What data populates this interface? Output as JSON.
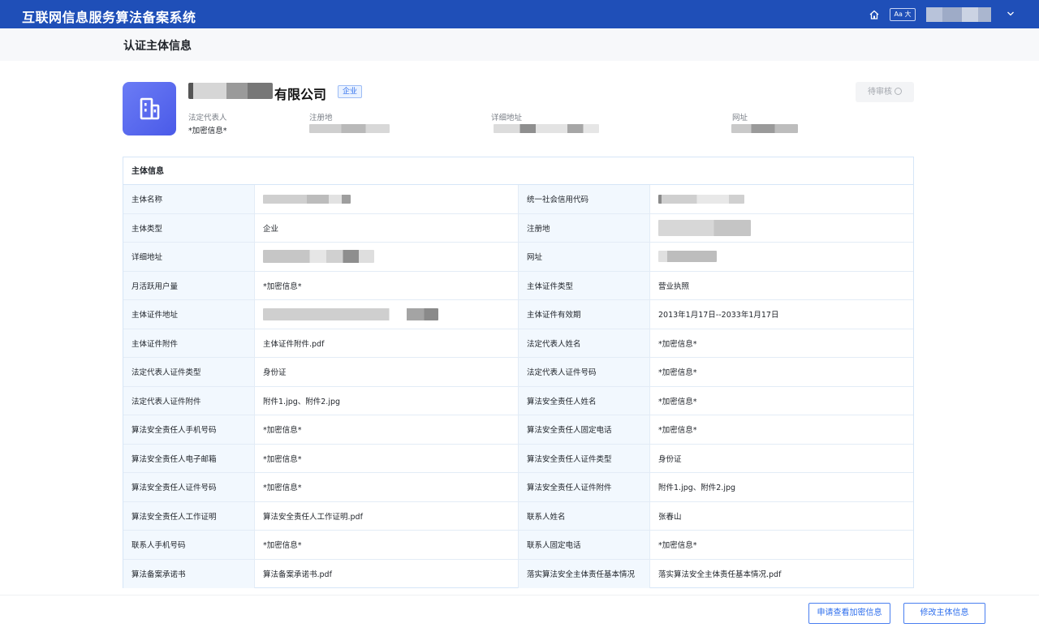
{
  "app": {
    "title": "互联网信息服务算法备案系统",
    "font_toggle_label": "Aa 大"
  },
  "page": {
    "title": "认证主体信息"
  },
  "entity": {
    "name_suffix": "有限公司",
    "type_badge": "企业",
    "status_label": "待审核",
    "meta": [
      {
        "label": "法定代表人",
        "value": "*加密信息*"
      },
      {
        "label": "注册地",
        "value": ""
      },
      {
        "label": "详细地址",
        "value": ""
      },
      {
        "label": "网址",
        "value": ""
      }
    ]
  },
  "info_section": {
    "title": "主体信息",
    "rows": [
      {
        "l_label": "主体名称",
        "l_value": "",
        "r_label": "统一社会信用代码",
        "r_value": ""
      },
      {
        "l_label": "主体类型",
        "l_value": "企业",
        "r_label": "注册地",
        "r_value": ""
      },
      {
        "l_label": "详细地址",
        "l_value": "",
        "r_label": "网址",
        "r_value": ""
      },
      {
        "l_label": "月活跃用户量",
        "l_value": "*加密信息*",
        "r_label": "主体证件类型",
        "r_value": "营业执照"
      },
      {
        "l_label": "主体证件地址",
        "l_value": "",
        "r_label": "主体证件有效期",
        "r_value": "2013年1月17日--2033年1月17日"
      },
      {
        "l_label": "主体证件附件",
        "l_value": "主体证件附件.pdf",
        "r_label": "法定代表人姓名",
        "r_value": "*加密信息*"
      },
      {
        "l_label": "法定代表人证件类型",
        "l_value": "身份证",
        "r_label": "法定代表人证件号码",
        "r_value": "*加密信息*"
      },
      {
        "l_label": "法定代表人证件附件",
        "l_value": "附件1.jpg、附件2.jpg",
        "r_label": "算法安全责任人姓名",
        "r_value": "*加密信息*"
      },
      {
        "l_label": "算法安全责任人手机号码",
        "l_value": "*加密信息*",
        "r_label": "算法安全责任人固定电话",
        "r_value": "*加密信息*"
      },
      {
        "l_label": "算法安全责任人电子邮箱",
        "l_value": "*加密信息*",
        "r_label": "算法安全责任人证件类型",
        "r_value": "身份证"
      },
      {
        "l_label": "算法安全责任人证件号码",
        "l_value": "*加密信息*",
        "r_label": "算法安全责任人证件附件",
        "r_value": "附件1.jpg、附件2.jpg"
      },
      {
        "l_label": "算法安全责任人工作证明",
        "l_value": "算法安全责任人工作证明.pdf",
        "r_label": "联系人姓名",
        "r_value": "张春山"
      },
      {
        "l_label": "联系人手机号码",
        "l_value": "*加密信息*",
        "r_label": "联系人固定电话",
        "r_value": "*加密信息*"
      },
      {
        "l_label": "算法备案承诺书",
        "l_value": "算法备案承诺书.pdf",
        "r_label": "落实算法安全主体责任基本情况",
        "r_value": "落实算法安全主体责任基本情况.pdf"
      }
    ]
  },
  "actions": {
    "view_encrypted_label": "申请查看加密信息",
    "edit_label": "修改主体信息"
  },
  "colors": {
    "topbar": "#1f4fb8",
    "accent": "#2f6fed",
    "label_bg": "#f2f8fe",
    "logo": "#5566ee"
  }
}
